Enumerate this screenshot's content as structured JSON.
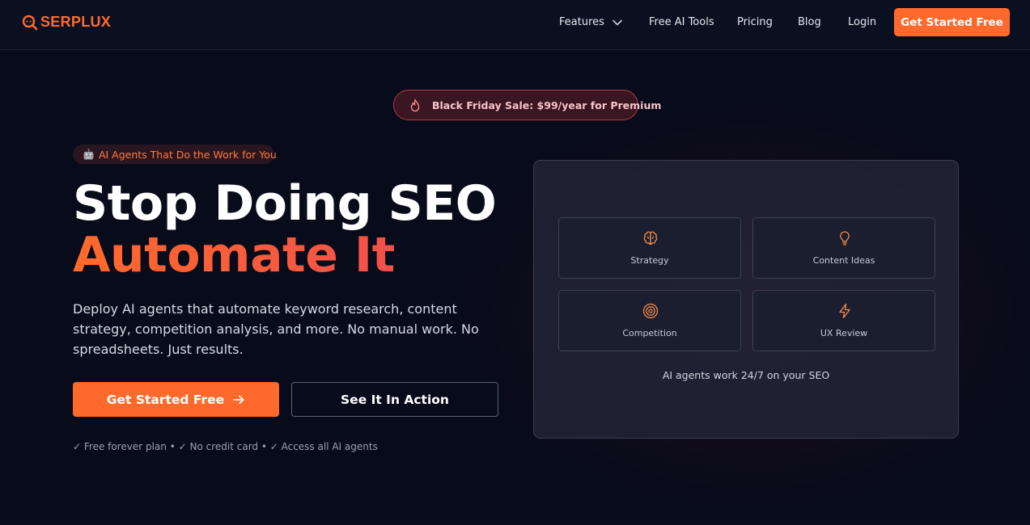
{
  "brand": {
    "name": "SERPLUX",
    "accent": "#ff6a2c"
  },
  "nav": {
    "items": [
      {
        "label": "Features"
      },
      {
        "label": "Free AI Tools"
      },
      {
        "label": "Pricing"
      },
      {
        "label": "Blog"
      },
      {
        "label": "Login"
      }
    ],
    "cta": "Get Started Free"
  },
  "sale": {
    "text": "Black Friday Sale: $99/year for Premium",
    "icon": "flame-icon"
  },
  "hero": {
    "badge_emoji": "🤖",
    "badge": "AI Agents That Do the Work for You",
    "title_line1": "Stop Doing SEO",
    "title_line2": "Automate It",
    "description": "Deploy AI agents that automate keyword research, content strategy, competition analysis, and more. No manual work. No spreadsheets. Just results.",
    "primary_cta": "Get Started Free",
    "secondary_cta": "See It In Action",
    "perks": "✓ Free forever plan • ✓ No credit card • ✓ Access all AI agents"
  },
  "agents_card": {
    "tiles": [
      {
        "label": "Strategy",
        "icon": "brain-icon"
      },
      {
        "label": "Content Ideas",
        "icon": "lightbulb-icon"
      },
      {
        "label": "Competition",
        "icon": "target-icon"
      },
      {
        "label": "UX Review",
        "icon": "lightning-icon"
      }
    ],
    "footer": "AI agents work 24/7 on your SEO"
  }
}
